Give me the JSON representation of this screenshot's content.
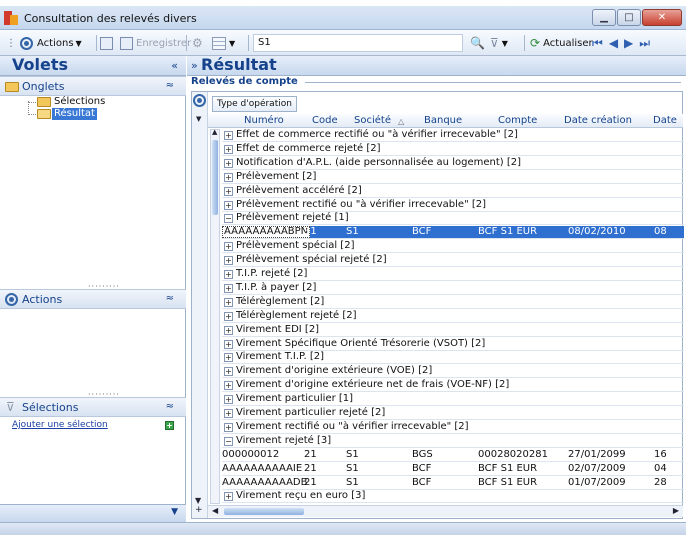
{
  "window": {
    "title": "Consultation des relevés divers"
  },
  "toolbar": {
    "actions_label": "Actions",
    "save_label": "Enregistrer",
    "search_value": "S1",
    "refresh_label": "Actualiser"
  },
  "left": {
    "header": "Volets",
    "onglets": {
      "title": "Onglets",
      "items": [
        "Sélections",
        "Résultat"
      ]
    },
    "actions": {
      "title": "Actions"
    },
    "selections": {
      "title": "Sélections",
      "add_link": "Ajouter une sélection"
    }
  },
  "right": {
    "header": "Résultat",
    "group_title": "Relevés de compte",
    "group_by": "Type d'opération",
    "columns": [
      "Numéro",
      "Code",
      "Société",
      "Banque",
      "Compte",
      "Date création",
      "Date"
    ],
    "rows": [
      {
        "kind": "group",
        "sign": "+",
        "text": "Effet de commerce rectifié ou \"à vérifier irrecevable\" [2]"
      },
      {
        "kind": "group",
        "sign": "+",
        "text": "Effet de commerce rejeté [2]"
      },
      {
        "kind": "group",
        "sign": "+",
        "text": "Notification d'A.P.L. (aide personnalisée au logement) [2]"
      },
      {
        "kind": "group",
        "sign": "+",
        "text": "Prélèvement [2]"
      },
      {
        "kind": "group",
        "sign": "+",
        "text": "Prélèvement accéléré [2]"
      },
      {
        "kind": "group",
        "sign": "+",
        "text": "Prélèvement rectifié ou \"à vérifier irrecevable\" [2]"
      },
      {
        "kind": "group",
        "sign": "−",
        "text": "Prélèvement rejeté [1]"
      },
      {
        "kind": "data",
        "selected": true,
        "numero": "AAAAAAAAABPN",
        "code": "31",
        "societe": "S1",
        "banque": "BCF",
        "compte": "BCF S1 EUR",
        "date_creation": "08/02/2010",
        "date": "08"
      },
      {
        "kind": "group",
        "sign": "+",
        "text": "Prélèvement spécial [2]"
      },
      {
        "kind": "group",
        "sign": "+",
        "text": "Prélèvement spécial rejeté [2]"
      },
      {
        "kind": "group",
        "sign": "+",
        "text": "T.I.P. rejeté [2]"
      },
      {
        "kind": "group",
        "sign": "+",
        "text": "T.I.P. à payer [2]"
      },
      {
        "kind": "group",
        "sign": "+",
        "text": "Télérèglement [2]"
      },
      {
        "kind": "group",
        "sign": "+",
        "text": "Télérèglement rejeté [2]"
      },
      {
        "kind": "group",
        "sign": "+",
        "text": "Virement EDI [2]"
      },
      {
        "kind": "group",
        "sign": "+",
        "text": "Virement Spécifique Orienté Trésorerie (VSOT) [2]"
      },
      {
        "kind": "group",
        "sign": "+",
        "text": "Virement T.I.P. [2]"
      },
      {
        "kind": "group",
        "sign": "+",
        "text": "Virement d'origine extérieure (VOE) [2]"
      },
      {
        "kind": "group",
        "sign": "+",
        "text": "Virement d'origine extérieure net de frais (VOE-NF) [2]"
      },
      {
        "kind": "group",
        "sign": "+",
        "text": "Virement particulier [1]"
      },
      {
        "kind": "group",
        "sign": "+",
        "text": "Virement particulier rejeté [2]"
      },
      {
        "kind": "group",
        "sign": "+",
        "text": "Virement rectifié ou \"à vérifier irrecevable\" [2]"
      },
      {
        "kind": "group",
        "sign": "−",
        "text": "Virement rejeté [3]"
      },
      {
        "kind": "data",
        "selected": false,
        "numero": "000000012",
        "code": "21",
        "societe": "S1",
        "banque": "BGS",
        "compte": "00028020281",
        "date_creation": "27/01/2099",
        "date": "16"
      },
      {
        "kind": "data",
        "selected": false,
        "numero": "AAAAAAAAAAIE",
        "code": "21",
        "societe": "S1",
        "banque": "BCF",
        "compte": "BCF S1 EUR",
        "date_creation": "02/07/2009",
        "date": "04"
      },
      {
        "kind": "data",
        "selected": false,
        "numero": "AAAAAAAAAADB",
        "code": "21",
        "societe": "S1",
        "banque": "BCF",
        "compte": "BCF S1 EUR",
        "date_creation": "01/07/2009",
        "date": "28"
      },
      {
        "kind": "group",
        "sign": "+",
        "text": "Virement reçu en euro [3]"
      }
    ]
  },
  "colors": {
    "accent": "#15428b",
    "selection": "#2f6fd0",
    "panel": "#c8d8ee"
  }
}
